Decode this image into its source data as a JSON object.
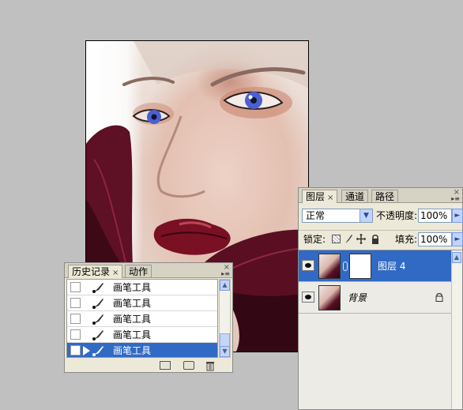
{
  "history_panel": {
    "tabs": [
      {
        "label": "历史记录",
        "close": "×"
      },
      {
        "label": "动作"
      }
    ],
    "close_glyph": "×",
    "items": [
      {
        "label": "画笔工具"
      },
      {
        "label": "画笔工具"
      },
      {
        "label": "画笔工具"
      },
      {
        "label": "画笔工具"
      },
      {
        "label": "画笔工具",
        "selected": true
      }
    ]
  },
  "layers_panel": {
    "tabs": [
      {
        "label": "图层",
        "close": "×"
      },
      {
        "label": "通道"
      },
      {
        "label": "路径"
      }
    ],
    "close_glyph": "×",
    "blend_mode": "正常",
    "opacity_label": "不透明度:",
    "opacity_value": "100%",
    "lock_label": "锁定:",
    "fill_label": "填充:",
    "fill_value": "100%",
    "layers": [
      {
        "name": "图层 4",
        "selected": true,
        "has_mask": true
      },
      {
        "name": "背景",
        "locked": true
      }
    ]
  },
  "colors": {
    "selection": "#316ac5",
    "panel_bg": "#ece9d8",
    "workspace_bg": "#c0c0c0"
  },
  "icons": [
    "brush-icon",
    "eye-icon",
    "lock-icon",
    "chain-icon",
    "trash-icon",
    "camera-icon",
    "new-document-icon",
    "panel-menu-icon"
  ]
}
